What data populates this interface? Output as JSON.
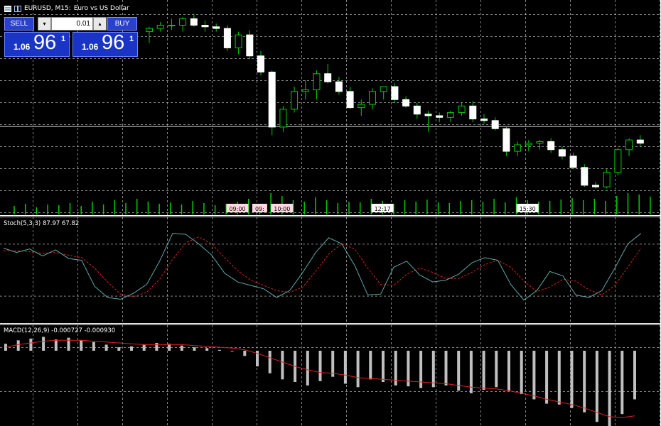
{
  "title": {
    "symbol_label": "EURUSD, M15:",
    "description": "Euro vs US Dollar"
  },
  "trade_panel": {
    "sell_label": "SELL",
    "buy_label": "BUY",
    "volume": "0.01",
    "stepper_down": "▾",
    "stepper_up": "▴",
    "sell_price": {
      "small": "1.06",
      "big": "96",
      "sup": "1"
    },
    "buy_price": {
      "small": "1.06",
      "big": "96",
      "sup": "1"
    }
  },
  "stoch_label": "Stoch(5,3,3) 87.97 67.82",
  "macd_label": "MACD(12,26,9) -0.000727 -0.000930",
  "colors": {
    "bull_body": "#000000",
    "bear_body": "#ffffff",
    "wick": "#00cc00",
    "volume": "#00cc00",
    "grid": "#cccccc",
    "stoch_main": "#5fa8a8",
    "stoch_signal": "#cc2222",
    "macd_hist": "#c0c0c0",
    "macd_signal": "#dd2020"
  },
  "chart_data": [
    {
      "type": "candlestick",
      "title": "EURUSD, M15: Euro vs US Dollar",
      "xlabel": "",
      "ylabel": "",
      "candles": [
        {
          "o": 92,
          "h": 95,
          "l": 85,
          "c": 94
        },
        {
          "o": 94,
          "h": 98,
          "l": 92,
          "c": 96
        },
        {
          "o": 96,
          "h": 100,
          "l": 93,
          "c": 96
        },
        {
          "o": 96,
          "h": 101,
          "l": 92,
          "c": 100
        },
        {
          "o": 100,
          "h": 103,
          "l": 95,
          "c": 96
        },
        {
          "o": 96,
          "h": 99,
          "l": 92,
          "c": 95
        },
        {
          "o": 95,
          "h": 97,
          "l": 92,
          "c": 94
        },
        {
          "o": 94,
          "h": 96,
          "l": 80,
          "c": 82
        },
        {
          "o": 82,
          "h": 92,
          "l": 78,
          "c": 90
        },
        {
          "o": 90,
          "h": 93,
          "l": 75,
          "c": 77
        },
        {
          "o": 77,
          "h": 80,
          "l": 65,
          "c": 67
        },
        {
          "o": 67,
          "h": 68,
          "l": 28,
          "c": 33
        },
        {
          "o": 33,
          "h": 46,
          "l": 30,
          "c": 44
        },
        {
          "o": 44,
          "h": 58,
          "l": 42,
          "c": 55
        },
        {
          "o": 55,
          "h": 62,
          "l": 50,
          "c": 56
        },
        {
          "o": 56,
          "h": 68,
          "l": 50,
          "c": 66
        },
        {
          "o": 66,
          "h": 72,
          "l": 60,
          "c": 61
        },
        {
          "o": 61,
          "h": 64,
          "l": 53,
          "c": 55
        },
        {
          "o": 55,
          "h": 58,
          "l": 44,
          "c": 45
        },
        {
          "o": 45,
          "h": 50,
          "l": 40,
          "c": 47
        },
        {
          "o": 47,
          "h": 57,
          "l": 44,
          "c": 55
        },
        {
          "o": 55,
          "h": 58,
          "l": 50,
          "c": 58
        },
        {
          "o": 58,
          "h": 60,
          "l": 48,
          "c": 50
        },
        {
          "o": 50,
          "h": 52,
          "l": 45,
          "c": 46
        },
        {
          "o": 46,
          "h": 48,
          "l": 38,
          "c": 41
        },
        {
          "o": 41,
          "h": 43,
          "l": 30,
          "c": 40
        },
        {
          "o": 40,
          "h": 42,
          "l": 36,
          "c": 39
        },
        {
          "o": 39,
          "h": 43,
          "l": 36,
          "c": 42
        },
        {
          "o": 42,
          "h": 48,
          "l": 40,
          "c": 46
        },
        {
          "o": 46,
          "h": 49,
          "l": 36,
          "c": 38
        },
        {
          "o": 38,
          "h": 41,
          "l": 35,
          "c": 37
        },
        {
          "o": 37,
          "h": 39,
          "l": 31,
          "c": 32
        },
        {
          "o": 32,
          "h": 33,
          "l": 15,
          "c": 18
        },
        {
          "o": 18,
          "h": 24,
          "l": 15,
          "c": 22
        },
        {
          "o": 22,
          "h": 25,
          "l": 18,
          "c": 23
        },
        {
          "o": 23,
          "h": 25,
          "l": 19,
          "c": 24
        },
        {
          "o": 24,
          "h": 26,
          "l": 17,
          "c": 19
        },
        {
          "o": 19,
          "h": 21,
          "l": 13,
          "c": 15
        },
        {
          "o": 15,
          "h": 17,
          "l": 7,
          "c": 8
        },
        {
          "o": 8,
          "h": 10,
          "l": -4,
          "c": -3
        },
        {
          "o": -3,
          "h": -1,
          "l": -5,
          "c": -4
        },
        {
          "o": -4,
          "h": 7,
          "l": -5,
          "c": 5
        },
        {
          "o": 5,
          "h": 20,
          "l": 3,
          "c": 19
        },
        {
          "o": 19,
          "h": 26,
          "l": 15,
          "c": 25
        },
        {
          "o": 25,
          "h": 28,
          "l": 21,
          "c": 23
        }
      ],
      "ylim": [
        -7,
        105
      ],
      "current_price": 33.5,
      "time_labels": [
        {
          "index": 20,
          "text": "09:00",
          "style": "pink"
        },
        {
          "index": 22,
          "text": "09:",
          "style": "pink"
        },
        {
          "index": 24,
          "text": "10:00",
          "style": "pink"
        },
        {
          "index": 33,
          "text": "12:17",
          "style": "white"
        },
        {
          "index": 46,
          "text": "15:30",
          "style": "white"
        }
      ]
    },
    {
      "type": "bar",
      "title": "",
      "xlabel": "",
      "ylabel": "",
      "values": [
        12,
        15,
        10,
        14,
        13,
        16,
        12,
        18,
        14,
        20,
        16,
        22,
        18,
        15,
        17,
        14,
        19,
        16,
        13,
        15,
        18,
        22,
        14,
        30,
        26,
        20,
        18,
        24,
        20,
        16,
        18,
        17,
        22,
        19,
        15,
        20,
        18,
        21,
        17,
        16,
        19,
        20,
        18,
        22,
        17,
        24,
        20,
        18,
        19,
        21,
        23,
        20,
        22,
        19,
        26,
        30,
        28,
        25,
        29,
        26,
        30,
        28,
        30,
        28
      ],
      "ylim": [
        0,
        30
      ]
    },
    {
      "type": "line",
      "title": "",
      "xlabel": "",
      "ylabel": "",
      "levels": [
        20,
        80
      ],
      "ylim": [
        0,
        100
      ],
      "series": [
        {
          "values": [
            75,
            70,
            74,
            66,
            73,
            63,
            61,
            31,
            18,
            16,
            23,
            33,
            60,
            92,
            91,
            80,
            67,
            46,
            36,
            32,
            28,
            18,
            26,
            47,
            70,
            87,
            80,
            55,
            21,
            22,
            53,
            60,
            44,
            36,
            38,
            45,
            58,
            64,
            61,
            33,
            15,
            26,
            48,
            43,
            21,
            18,
            26,
            52,
            80,
            92
          ]
        },
        {
          "values": [
            72,
            72,
            71,
            69,
            70,
            67,
            64,
            52,
            36,
            22,
            19,
            24,
            39,
            62,
            81,
            88,
            80,
            64,
            49,
            38,
            32,
            26,
            24,
            30,
            48,
            68,
            80,
            74,
            52,
            33,
            32,
            45,
            52,
            47,
            40,
            40,
            47,
            56,
            61,
            53,
            37,
            25,
            30,
            39,
            37,
            27,
            21,
            32,
            53,
            75
          ]
        }
      ]
    },
    {
      "type": "bar",
      "title": "",
      "xlabel": "",
      "ylabel": "",
      "ylim": [
        -0.0009,
        0.00018
      ],
      "series": [
        {
          "values": [
            8e-05,
            0.00012,
            0.00014,
            0.00016,
            0.00013,
            0.00015,
            0.00012,
            0.0001,
            7e-05,
            4e-05,
            5e-05,
            7e-05,
            9e-05,
            8e-05,
            6e-05,
            4e-05,
            3e-05,
            1e-05,
            0.0,
            -6e-05,
            -0.00018,
            -0.00026,
            -0.00033,
            -0.00036,
            -0.0004,
            -0.00035,
            -0.0003,
            -0.00038,
            -0.00042,
            -0.00033,
            -0.00036,
            -0.0004,
            -0.00041,
            -0.00043,
            -0.00042,
            -0.0004,
            -0.00046,
            -0.00049,
            -0.00045,
            -0.00042,
            -0.00046,
            -0.0005,
            -0.00056,
            -0.00061,
            -0.00062,
            -0.00066,
            -0.00071,
            -0.00082,
            -0.00087,
            -0.00073,
            -0.00056
          ]
        },
        {
          "values": [
            4e-05,
            7e-05,
            9e-05,
            0.00011,
            0.00012,
            0.00012,
            0.00012,
            0.00011,
            0.0001,
            9e-05,
            8e-05,
            7e-05,
            7e-05,
            7e-05,
            7e-05,
            6e-05,
            5e-05,
            4e-05,
            3e-05,
            1e-05,
            -3e-05,
            -8e-05,
            -0.00013,
            -0.00018,
            -0.00022,
            -0.00025,
            -0.00026,
            -0.00028,
            -0.00031,
            -0.00032,
            -0.00033,
            -0.00034,
            -0.00035,
            -0.00036,
            -0.00037,
            -0.00038,
            -0.0004,
            -0.00042,
            -0.00043,
            -0.00044,
            -0.00046,
            -0.00049,
            -0.00052,
            -0.00056,
            -0.00059,
            -0.00062,
            -0.00066,
            -0.00071,
            -0.00076,
            -0.00077,
            -0.00075
          ]
        }
      ]
    }
  ]
}
